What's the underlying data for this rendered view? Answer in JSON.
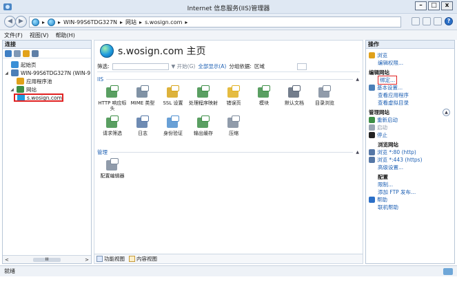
{
  "window": {
    "title": "Internet 信息服务(IIS)管理器",
    "buttons": [
      "–",
      "□",
      "x"
    ]
  },
  "address": {
    "crumbs": [
      "WIN-99S6TDG327N",
      "网站",
      "s.wosign.com"
    ],
    "separator": "▸"
  },
  "menu": [
    "文件(F)",
    "视图(V)",
    "帮助(H)"
  ],
  "connections": {
    "header": "连接",
    "tree": [
      {
        "label": "起始页",
        "level": 1,
        "expander": "",
        "color": "#3a8fd6"
      },
      {
        "label": "WIN-99S6TDG327N (WIN-9",
        "level": 1,
        "expander": "◢",
        "color": "#4c7fb8"
      },
      {
        "label": "应用程序池",
        "level": 2,
        "expander": "",
        "color": "#e0a11b"
      },
      {
        "label": "网站",
        "level": 2,
        "expander": "◢",
        "color": "#3d8e46"
      },
      {
        "label": "s.wosign.com",
        "level": 3,
        "expander": "",
        "color": "#1e9be0",
        "selected": true
      }
    ],
    "scroll": {
      "left": "<",
      "thumb": "III",
      "right": ">"
    }
  },
  "main": {
    "title": "s.wosign.com 主页",
    "filter": {
      "label": "筛选:",
      "go": "▼ 开始(G)",
      "show_all": "全部显示(A)",
      "group_by_label": "分组依据:",
      "group_by_value": "区域"
    },
    "sections": [
      {
        "name": "IIS",
        "features": [
          {
            "label": "HTTP 响应标头",
            "icon": "http-response-headers-icon",
            "color": "#3d8e46"
          },
          {
            "label": "MIME 类型",
            "icon": "mime-types-icon",
            "color": "#6a7f95"
          },
          {
            "label": "SSL 设置",
            "icon": "ssl-lock-icon",
            "color": "#d7a419"
          },
          {
            "label": "处理程序映射",
            "icon": "handler-mappings-icon",
            "color": "#3d8e46"
          },
          {
            "label": "错误页",
            "icon": "error-pages-icon",
            "color": "#e0b020"
          },
          {
            "label": "模块",
            "icon": "modules-icon",
            "color": "#3d8e46"
          },
          {
            "label": "默认文档",
            "icon": "default-document-icon",
            "color": "#5b6678"
          },
          {
            "label": "目录浏览",
            "icon": "directory-browsing-icon",
            "color": "#7d8a9b"
          },
          {
            "label": "请求筛选",
            "icon": "request-filtering-icon",
            "color": "#3d8e46"
          },
          {
            "label": "日志",
            "icon": "logging-icon",
            "color": "#5577a6"
          },
          {
            "label": "身份验证",
            "icon": "authentication-icon",
            "color": "#4f8fcf"
          },
          {
            "label": "输出缓存",
            "icon": "output-caching-icon",
            "color": "#3d8e46"
          },
          {
            "label": "压缩",
            "icon": "compression-icon",
            "color": "#7d8a9b"
          }
        ]
      },
      {
        "name": "管理",
        "features": [
          {
            "label": "配置编辑器",
            "icon": "configuration-editor-icon",
            "color": "#7d8a9b"
          }
        ]
      }
    ],
    "view_tabs": [
      "功能视图",
      "内容视图"
    ]
  },
  "actions": {
    "header": "操作",
    "rows": [
      {
        "type": "link",
        "label": "浏览",
        "icon": "explore-icon",
        "color": "#e0a11b"
      },
      {
        "type": "link",
        "label": "编辑权限...",
        "indent": true
      },
      {
        "type": "group",
        "label": "编辑网站"
      },
      {
        "type": "link",
        "label": "绑定...",
        "indent": true,
        "highlight": true
      },
      {
        "type": "link",
        "label": "基本设置...",
        "icon": "basic-settings-icon",
        "color": "#4c7fb8"
      },
      {
        "type": "link",
        "label": "查看应用程序",
        "indent": true
      },
      {
        "type": "link",
        "label": "查看虚拟目录",
        "indent": true
      },
      {
        "type": "group",
        "label": "管理网站",
        "collapse": true
      },
      {
        "type": "link",
        "label": "重新启动",
        "icon": "restart-icon",
        "color": "#3d8e46"
      },
      {
        "type": "link",
        "label": "启动",
        "icon": "start-icon",
        "color": "#9aa6b4",
        "disabled": true
      },
      {
        "type": "link",
        "label": "停止",
        "icon": "stop-icon",
        "color": "#222222"
      },
      {
        "type": "group",
        "label": "浏览网站",
        "indent": true
      },
      {
        "type": "link",
        "label": "浏览 *:80 (http)",
        "icon": "browse-icon",
        "color": "#5577a6"
      },
      {
        "type": "link",
        "label": "浏览 *:443 (https)",
        "icon": "browse-icon",
        "color": "#5577a6"
      },
      {
        "type": "link",
        "label": "高级设置...",
        "indent": true
      },
      {
        "type": "group",
        "label": "配置",
        "indent": true
      },
      {
        "type": "link",
        "label": "限制...",
        "indent": true
      },
      {
        "type": "link",
        "label": "添加 FTP 发布...",
        "indent": true
      },
      {
        "type": "link",
        "label": "帮助",
        "icon": "help-icon",
        "color": "#2b6fc7"
      },
      {
        "type": "link",
        "label": "联机帮助",
        "indent": true
      }
    ]
  },
  "status": {
    "text": "就绪"
  }
}
